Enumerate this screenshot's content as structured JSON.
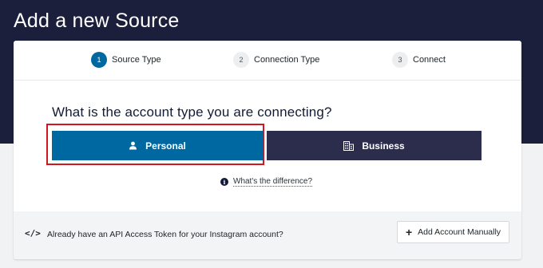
{
  "page": {
    "title": "Add a new Source"
  },
  "stepper": {
    "steps": [
      {
        "number": "1",
        "label": "Source Type",
        "active": true
      },
      {
        "number": "2",
        "label": "Connection Type",
        "active": false
      },
      {
        "number": "3",
        "label": "Connect",
        "active": false
      }
    ]
  },
  "question": "What is the account type you are connecting?",
  "options": {
    "personal": {
      "label": "Personal",
      "icon": "user-icon"
    },
    "business": {
      "label": "Business",
      "icon": "building-icon"
    }
  },
  "difference_link": "What's the difference?",
  "footer": {
    "icon": "code-icon",
    "text": "Already have an API Access Token for your Instagram account?",
    "button_label": "Add Account Manually"
  },
  "colors": {
    "header_bg": "#1b1f3b",
    "primary": "#0068a0",
    "business": "#2c2d4d",
    "highlight": "#d0161e"
  }
}
